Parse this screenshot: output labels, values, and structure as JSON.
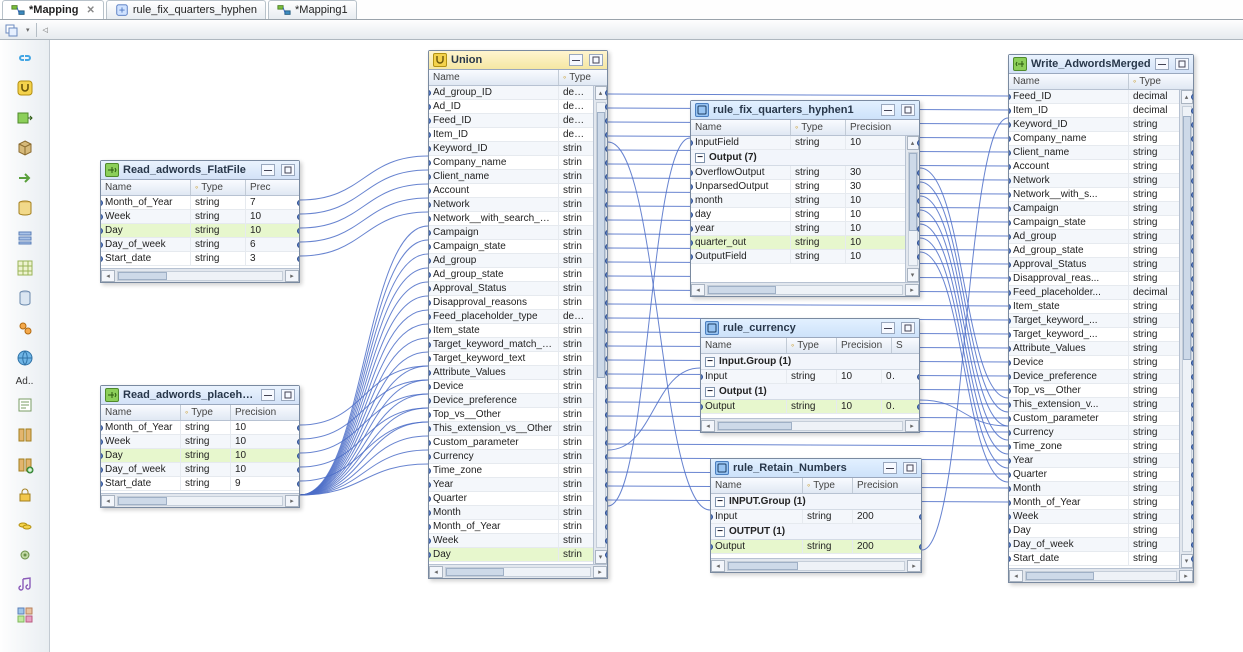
{
  "tabs": [
    {
      "label": "*Mapping",
      "active": true,
      "closable": true,
      "icon": "mapping-icon"
    },
    {
      "label": "rule_fix_quarters_hyphen",
      "active": false,
      "closable": false,
      "icon": "rule-icon"
    },
    {
      "label": "*Mapping1",
      "active": false,
      "closable": false,
      "icon": "mapping-icon"
    }
  ],
  "toolbar": {
    "dropdown_hint": "▾",
    "back_hint": "◁"
  },
  "palette": {
    "ad_label": "Ad..",
    "items": [
      "link-icon",
      "union-icon",
      "output-icon",
      "cube-icon",
      "arrow-right-icon",
      "db-icon",
      "stack-icon",
      "grid-icon",
      "barrel-icon",
      "gears-icon",
      "globe-source-icon",
      "address-icon",
      "book-icon",
      "book-plus-icon",
      "lock-icon",
      "coins-icon",
      "gear-mini-icon",
      "music-icon",
      "tiles-icon"
    ]
  },
  "columns": {
    "name": "Name",
    "type": "Type",
    "precision": "Precision",
    "prec": "Prec",
    "s": "S"
  },
  "nodes": {
    "read_flat": {
      "title": "Read_adwords_FlatFile",
      "cols": [
        "Name",
        "Type",
        "Prec"
      ],
      "rows": [
        {
          "n": "Month_of_Year",
          "t": "string",
          "p": "7"
        },
        {
          "n": "Week",
          "t": "string",
          "p": "10"
        },
        {
          "n": "Day",
          "t": "string",
          "p": "10",
          "hl": true
        },
        {
          "n": "Day_of_week",
          "t": "string",
          "p": "6"
        },
        {
          "n": "Start_date",
          "t": "string",
          "p": "3"
        }
      ]
    },
    "read_ph": {
      "title": "Read_adwords_placeholderFee...",
      "cols": [
        "Name",
        "Type",
        "Precision"
      ],
      "rows": [
        {
          "n": "Month_of_Year",
          "t": "string",
          "p": "10"
        },
        {
          "n": "Week",
          "t": "string",
          "p": "10"
        },
        {
          "n": "Day",
          "t": "string",
          "p": "10",
          "hl": true
        },
        {
          "n": "Day_of_week",
          "t": "string",
          "p": "10"
        },
        {
          "n": "Start_date",
          "t": "string",
          "p": "9"
        }
      ]
    },
    "union": {
      "title": "Union",
      "cols": [
        "Name",
        "Type"
      ],
      "rows": [
        {
          "n": "Ad_group_ID",
          "t": "decim"
        },
        {
          "n": "Ad_ID",
          "t": "decim"
        },
        {
          "n": "Feed_ID",
          "t": "decim"
        },
        {
          "n": "Item_ID",
          "t": "decim"
        },
        {
          "n": "Keyword_ID",
          "t": "strin"
        },
        {
          "n": "Company_name",
          "t": "strin"
        },
        {
          "n": "Client_name",
          "t": "strin"
        },
        {
          "n": "Account",
          "t": "strin"
        },
        {
          "n": "Network",
          "t": "strin"
        },
        {
          "n": "Network__with_search_pa...",
          "t": "strin"
        },
        {
          "n": "Campaign",
          "t": "strin"
        },
        {
          "n": "Campaign_state",
          "t": "strin"
        },
        {
          "n": "Ad_group",
          "t": "strin"
        },
        {
          "n": "Ad_group_state",
          "t": "strin"
        },
        {
          "n": "Approval_Status",
          "t": "strin"
        },
        {
          "n": "Disapproval_reasons",
          "t": "strin"
        },
        {
          "n": "Feed_placeholder_type",
          "t": "decim"
        },
        {
          "n": "Item_state",
          "t": "strin"
        },
        {
          "n": "Target_keyword_match_ty...",
          "t": "strin"
        },
        {
          "n": "Target_keyword_text",
          "t": "strin"
        },
        {
          "n": "Attribute_Values",
          "t": "strin"
        },
        {
          "n": "Device",
          "t": "strin"
        },
        {
          "n": "Device_preference",
          "t": "strin"
        },
        {
          "n": "Top_vs__Other",
          "t": "strin"
        },
        {
          "n": "This_extension_vs__Other",
          "t": "strin"
        },
        {
          "n": "Custom_parameter",
          "t": "strin"
        },
        {
          "n": "Currency",
          "t": "strin"
        },
        {
          "n": "Time_zone",
          "t": "strin"
        },
        {
          "n": "Year",
          "t": "strin"
        },
        {
          "n": "Quarter",
          "t": "strin"
        },
        {
          "n": "Month",
          "t": "strin"
        },
        {
          "n": "Month_of_Year",
          "t": "strin"
        },
        {
          "n": "Week",
          "t": "strin"
        },
        {
          "n": "Day",
          "t": "strin",
          "hl": true
        }
      ]
    },
    "rule_fqh": {
      "title": "rule_fix_quarters_hyphen1",
      "cols": [
        "Name",
        "Type",
        "Precision"
      ],
      "input_rows": [
        {
          "n": "InputField",
          "t": "string",
          "p": "10"
        }
      ],
      "output_label": "Output (7)",
      "output_rows": [
        {
          "n": "OverflowOutput",
          "t": "string",
          "p": "30"
        },
        {
          "n": "UnparsedOutput",
          "t": "string",
          "p": "30"
        },
        {
          "n": "month",
          "t": "string",
          "p": "10"
        },
        {
          "n": "day",
          "t": "string",
          "p": "10"
        },
        {
          "n": "year",
          "t": "string",
          "p": "10"
        },
        {
          "n": "quarter_out",
          "t": "string",
          "p": "10",
          "hl": true
        },
        {
          "n": "OutputField",
          "t": "string",
          "p": "10"
        }
      ]
    },
    "rule_currency": {
      "title": "rule_currency",
      "cols": [
        "Name",
        "Type",
        "Precision",
        "S"
      ],
      "input_label": "Input.Group (1)",
      "input_rows": [
        {
          "n": "Input",
          "t": "string",
          "p": "10",
          "s": "0"
        }
      ],
      "output_label": "Output (1)",
      "output_rows": [
        {
          "n": "Output",
          "t": "string",
          "p": "10",
          "s": "0",
          "hl": true
        }
      ]
    },
    "rule_retain": {
      "title": "rule_Retain_Numbers",
      "cols": [
        "Name",
        "Type",
        "Precision"
      ],
      "input_label": "INPUT.Group (1)",
      "input_rows": [
        {
          "n": "Input",
          "t": "string",
          "p": "200"
        }
      ],
      "output_label": "OUTPUT (1)",
      "output_rows": [
        {
          "n": "Output",
          "t": "string",
          "p": "200",
          "hl": true
        }
      ]
    },
    "write": {
      "title": "Write_AdwordsMerged",
      "cols": [
        "Name",
        "Type"
      ],
      "rows": [
        {
          "n": "Feed_ID",
          "t": "decimal"
        },
        {
          "n": "Item_ID",
          "t": "decimal"
        },
        {
          "n": "Keyword_ID",
          "t": "string"
        },
        {
          "n": "Company_name",
          "t": "string"
        },
        {
          "n": "Client_name",
          "t": "string"
        },
        {
          "n": "Account",
          "t": "string"
        },
        {
          "n": "Network",
          "t": "string"
        },
        {
          "n": "Network__with_s...",
          "t": "string"
        },
        {
          "n": "Campaign",
          "t": "string"
        },
        {
          "n": "Campaign_state",
          "t": "string"
        },
        {
          "n": "Ad_group",
          "t": "string"
        },
        {
          "n": "Ad_group_state",
          "t": "string"
        },
        {
          "n": "Approval_Status",
          "t": "string"
        },
        {
          "n": "Disapproval_reas...",
          "t": "string"
        },
        {
          "n": "Feed_placeholder...",
          "t": "decimal"
        },
        {
          "n": "Item_state",
          "t": "string"
        },
        {
          "n": "Target_keyword_...",
          "t": "string"
        },
        {
          "n": "Target_keyword_...",
          "t": "string"
        },
        {
          "n": "Attribute_Values",
          "t": "string"
        },
        {
          "n": "Device",
          "t": "string"
        },
        {
          "n": "Device_preference",
          "t": "string"
        },
        {
          "n": "Top_vs__Other",
          "t": "string"
        },
        {
          "n": "This_extension_v...",
          "t": "string"
        },
        {
          "n": "Custom_parameter",
          "t": "string"
        },
        {
          "n": "Currency",
          "t": "string"
        },
        {
          "n": "Time_zone",
          "t": "string"
        },
        {
          "n": "Year",
          "t": "string"
        },
        {
          "n": "Quarter",
          "t": "string"
        },
        {
          "n": "Month",
          "t": "string"
        },
        {
          "n": "Month_of_Year",
          "t": "string"
        },
        {
          "n": "Week",
          "t": "string"
        },
        {
          "n": "Day",
          "t": "string"
        },
        {
          "n": "Day_of_week",
          "t": "string"
        },
        {
          "n": "Start_date",
          "t": "string"
        }
      ]
    }
  }
}
